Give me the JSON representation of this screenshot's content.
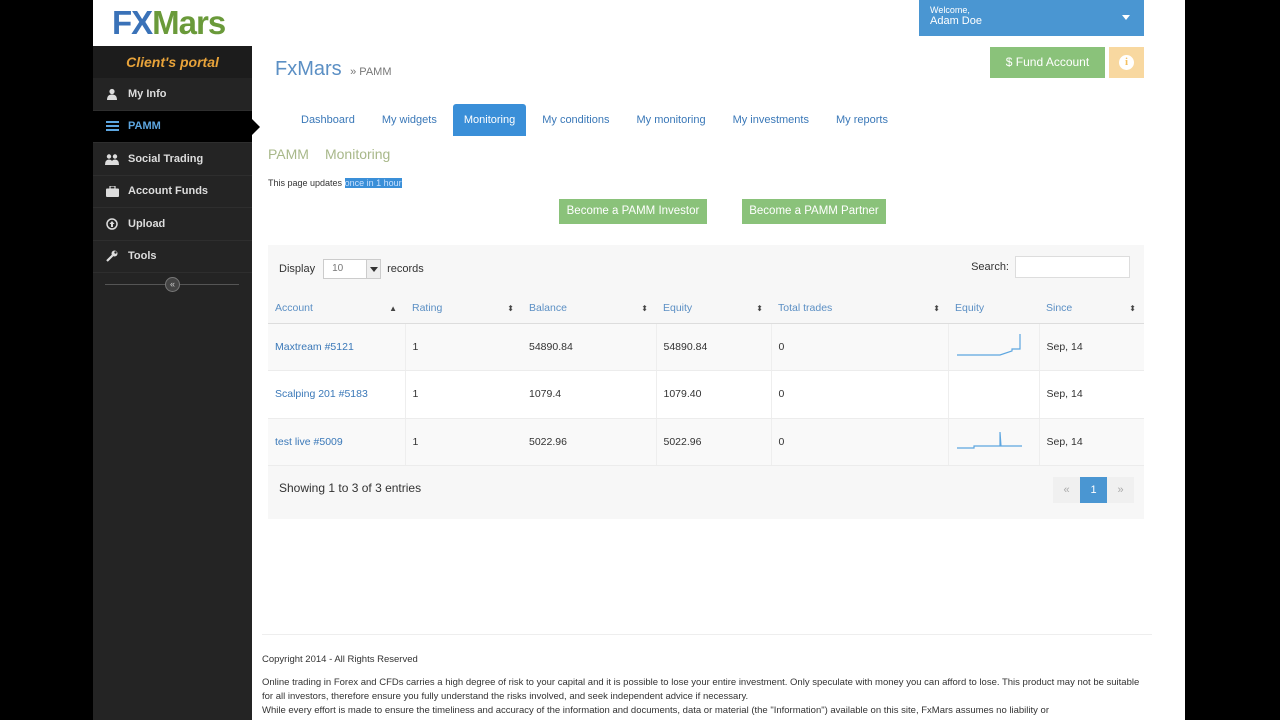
{
  "logo": {
    "fx": "FX",
    "mars": "Mars"
  },
  "sidebar": {
    "portal_label": "Client's portal",
    "items": [
      {
        "label": "My Info",
        "icon": "user-icon"
      },
      {
        "label": "PAMM",
        "icon": "bars-icon"
      },
      {
        "label": "Social Trading",
        "icon": "users-icon"
      },
      {
        "label": "Account Funds",
        "icon": "briefcase-icon"
      },
      {
        "label": "Upload",
        "icon": "upload-icon"
      },
      {
        "label": "Tools",
        "icon": "wrench-icon"
      }
    ]
  },
  "header": {
    "welcome_label": "Welcome,",
    "user_name": "Adam Doe",
    "fund_label": "$ Fund Account",
    "title": "FxMars",
    "crumb": "» PAMM"
  },
  "tabs": [
    "Dashboard",
    "My widgets",
    "Monitoring",
    "My conditions",
    "My monitoring",
    "My investments",
    "My reports"
  ],
  "subhead": {
    "a": "PAMM",
    "b": "Monitoring"
  },
  "update": {
    "prefix": "This page updates ",
    "highlight": "once in 1 hour"
  },
  "buttons": {
    "investor": "Become a PAMM Investor",
    "partner": "Become a PAMM Partner"
  },
  "table": {
    "display_label": "Display",
    "display_value": "10",
    "records_label": "records",
    "search_label": "Search:",
    "columns": [
      "Account",
      "Rating",
      "Balance",
      "Equity",
      "Total trades",
      "Equity",
      "Since"
    ],
    "rows": [
      {
        "account": "Maxtream #5121",
        "rating": "1",
        "balance": "54890.84",
        "equity": "54890.84",
        "trades": "0",
        "since": "Sep, 14"
      },
      {
        "account": "Scalping 201 #5183",
        "rating": "1",
        "balance": "1079.4",
        "equity": "1079.40",
        "trades": "0",
        "since": "Sep, 14"
      },
      {
        "account": "test live #5009",
        "rating": "1",
        "balance": "5022.96",
        "equity": "5022.96",
        "trades": "0",
        "since": "Sep, 14"
      }
    ],
    "showing": "Showing 1 to 3 of 3 entries",
    "pager": {
      "prev": "«",
      "current": "1",
      "next": "»"
    }
  },
  "footer": {
    "copyright": "Copyright 2014 - All Rights Reserved",
    "disclaimer": "Online trading in Forex and CFDs carries a high degree of risk to your capital and it is possible to lose your entire investment. Only speculate with money you can afford to lose. This product may not be suitable for all investors, therefore ensure you fully understand the risks involved, and seek independent advice if necessary.",
    "disclaimer2": "While every effort is made to ensure the timeliness and accuracy of the information and documents, data or material (the \"Information\") available on this site, FxMars assumes no liability or"
  }
}
